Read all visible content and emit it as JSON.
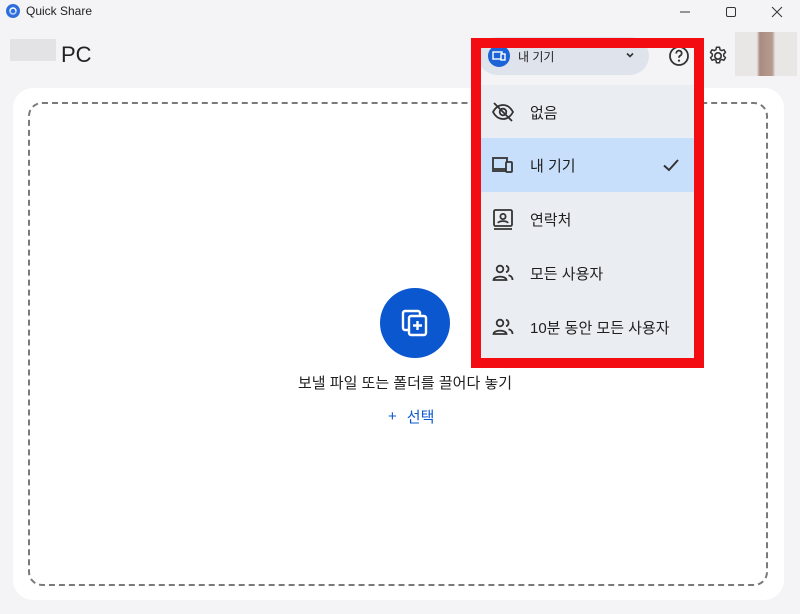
{
  "window": {
    "title": "Quick Share",
    "minimize_glyph": "—",
    "maximize_glyph": "☐",
    "close_glyph": "✕"
  },
  "header": {
    "device_name": "PC",
    "visibility_label": "내 기기"
  },
  "dropzone": {
    "text": "보낼 파일 또는 폴더를 끌어다 놓기",
    "select_label": "선택",
    "select_plus": "+"
  },
  "menu": {
    "items": [
      {
        "label": "없음",
        "icon": "eye-off-icon",
        "selected": false
      },
      {
        "label": "내 기기",
        "icon": "devices-icon",
        "selected": true
      },
      {
        "label": "연락처",
        "icon": "contact-card-icon",
        "selected": false
      },
      {
        "label": "모든 사용자",
        "icon": "people-icon",
        "selected": false
      },
      {
        "label": "10분 동안 모든 사용자",
        "icon": "people-icon",
        "selected": false
      }
    ]
  },
  "colors": {
    "accent": "#0b57d0",
    "highlight_border": "#f30d12",
    "selected_bg": "#c8dffb"
  }
}
